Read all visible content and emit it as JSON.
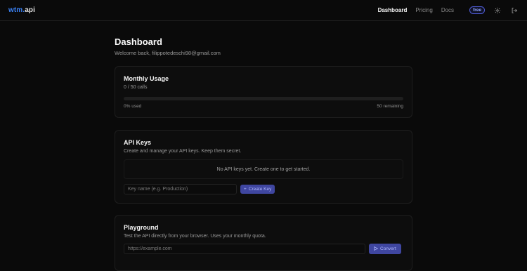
{
  "header": {
    "logo_prefix": "wtm",
    "logo_dot": ".",
    "logo_suffix": "api",
    "nav": [
      {
        "label": "Dashboard"
      },
      {
        "label": "Pricing"
      },
      {
        "label": "Docs"
      }
    ],
    "plan_badge": "free",
    "icons": [
      "settings-icon",
      "logout-icon"
    ]
  },
  "page": {
    "title": "Dashboard",
    "welcome": "Welcome back, filippotedeschi98@gmail.com"
  },
  "usage": {
    "title": "Monthly Usage",
    "calls": "0 / 50 calls",
    "used_label": "0% used",
    "remaining_label": "50 remaining",
    "progress_fraction": 0
  },
  "api_keys": {
    "title": "API Keys",
    "subtitle": "Create and manage your API keys. Keep them secret.",
    "empty_text": "No API keys yet. Create one to get started.",
    "input_placeholder": "Key name (e.g. Production)",
    "create_label": "Create Key"
  },
  "playground": {
    "title": "Playground",
    "subtitle": "Test the API directly from your browser. Uses your monthly quota.",
    "input_placeholder": "https://example.com",
    "convert_label": "Convert"
  },
  "colors": {
    "accent": "#4f5bd5",
    "background": "#0a0a0a"
  }
}
